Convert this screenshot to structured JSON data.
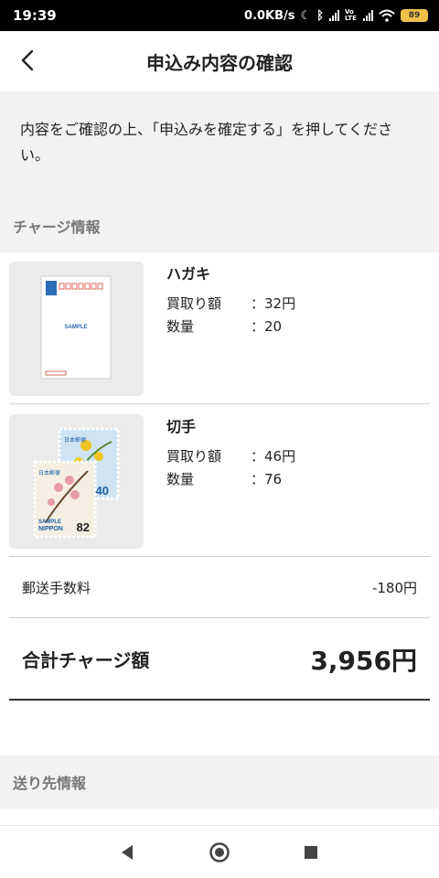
{
  "status_bar": {
    "time": "19:39",
    "speed": "0.0KB/s",
    "battery": "89",
    "volte": "Vo LTE"
  },
  "app_bar": {
    "title": "申込み内容の確認",
    "back_icon": "chevron-left-icon"
  },
  "intro": {
    "text": "内容をご確認の上、「申込みを確定する」を押してください。"
  },
  "charge_section": {
    "title": "チャージ情報",
    "items": [
      {
        "name": "ハガキ",
        "price_label": "買取り額",
        "price_value": "：32円",
        "qty_label": "数量",
        "qty_value": "：20",
        "thumb_text": "SAMPLE"
      },
      {
        "name": "切手",
        "price_label": "買取り額",
        "price_value": "：46円",
        "qty_label": "数量",
        "qty_value": "：76",
        "stamp_a_value": "140",
        "stamp_b_value": "82",
        "stamp_sample": "SAMPLE",
        "stamp_nippon": "NIPPON",
        "stamp_country": "日本郵便"
      }
    ],
    "shipping_fee_label": "郵送手数料",
    "shipping_fee_value": "-180円",
    "total_label": "合計チャージ額",
    "total_value": "3,956円"
  },
  "shipping_section": {
    "title": "送り先情報"
  },
  "nav": {
    "back_icon": "nav-back-icon",
    "home_icon": "nav-home-icon",
    "recents_icon": "nav-recents-icon"
  },
  "colors": {
    "background": "#ffffff",
    "section_gray": "#f2f2f3",
    "thumb_bg": "#ebebeb",
    "battery": "#f2c14a"
  }
}
